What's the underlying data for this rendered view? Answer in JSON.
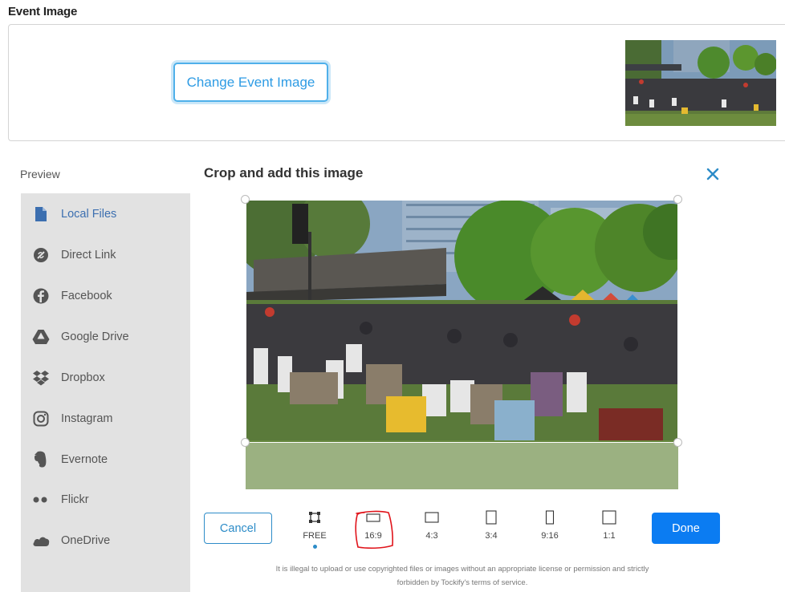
{
  "section_title": "Event Image",
  "change_button_label": "Change Event Image",
  "preview_label": "Preview",
  "sidebar": {
    "items": [
      {
        "label": "Local Files",
        "icon": "file-icon",
        "active": true
      },
      {
        "label": "Direct Link",
        "icon": "link-icon"
      },
      {
        "label": "Facebook",
        "icon": "facebook-icon"
      },
      {
        "label": "Google Drive",
        "icon": "google-drive-icon"
      },
      {
        "label": "Dropbox",
        "icon": "dropbox-icon"
      },
      {
        "label": "Instagram",
        "icon": "instagram-icon"
      },
      {
        "label": "Evernote",
        "icon": "evernote-icon"
      },
      {
        "label": "Flickr",
        "icon": "flickr-icon"
      },
      {
        "label": "OneDrive",
        "icon": "onedrive-icon"
      }
    ]
  },
  "crop": {
    "title": "Crop and add this image",
    "cancel_label": "Cancel",
    "done_label": "Done",
    "ratios": [
      {
        "label": "FREE",
        "selected": true
      },
      {
        "label": "16:9"
      },
      {
        "label": "4:3"
      },
      {
        "label": "3:4"
      },
      {
        "label": "9:16"
      },
      {
        "label": "1:1"
      }
    ],
    "legal_line1": "It is illegal to upload or use copyrighted files or images without an appropriate license or permission and strictly",
    "legal_line2": "forbidden by Tockify's terms of service."
  },
  "colors": {
    "accent": "#0b7cf2",
    "link_blue": "#2d8cc8",
    "sidebar_bg": "#e2e2e2",
    "annotation_red": "#e0141b"
  }
}
